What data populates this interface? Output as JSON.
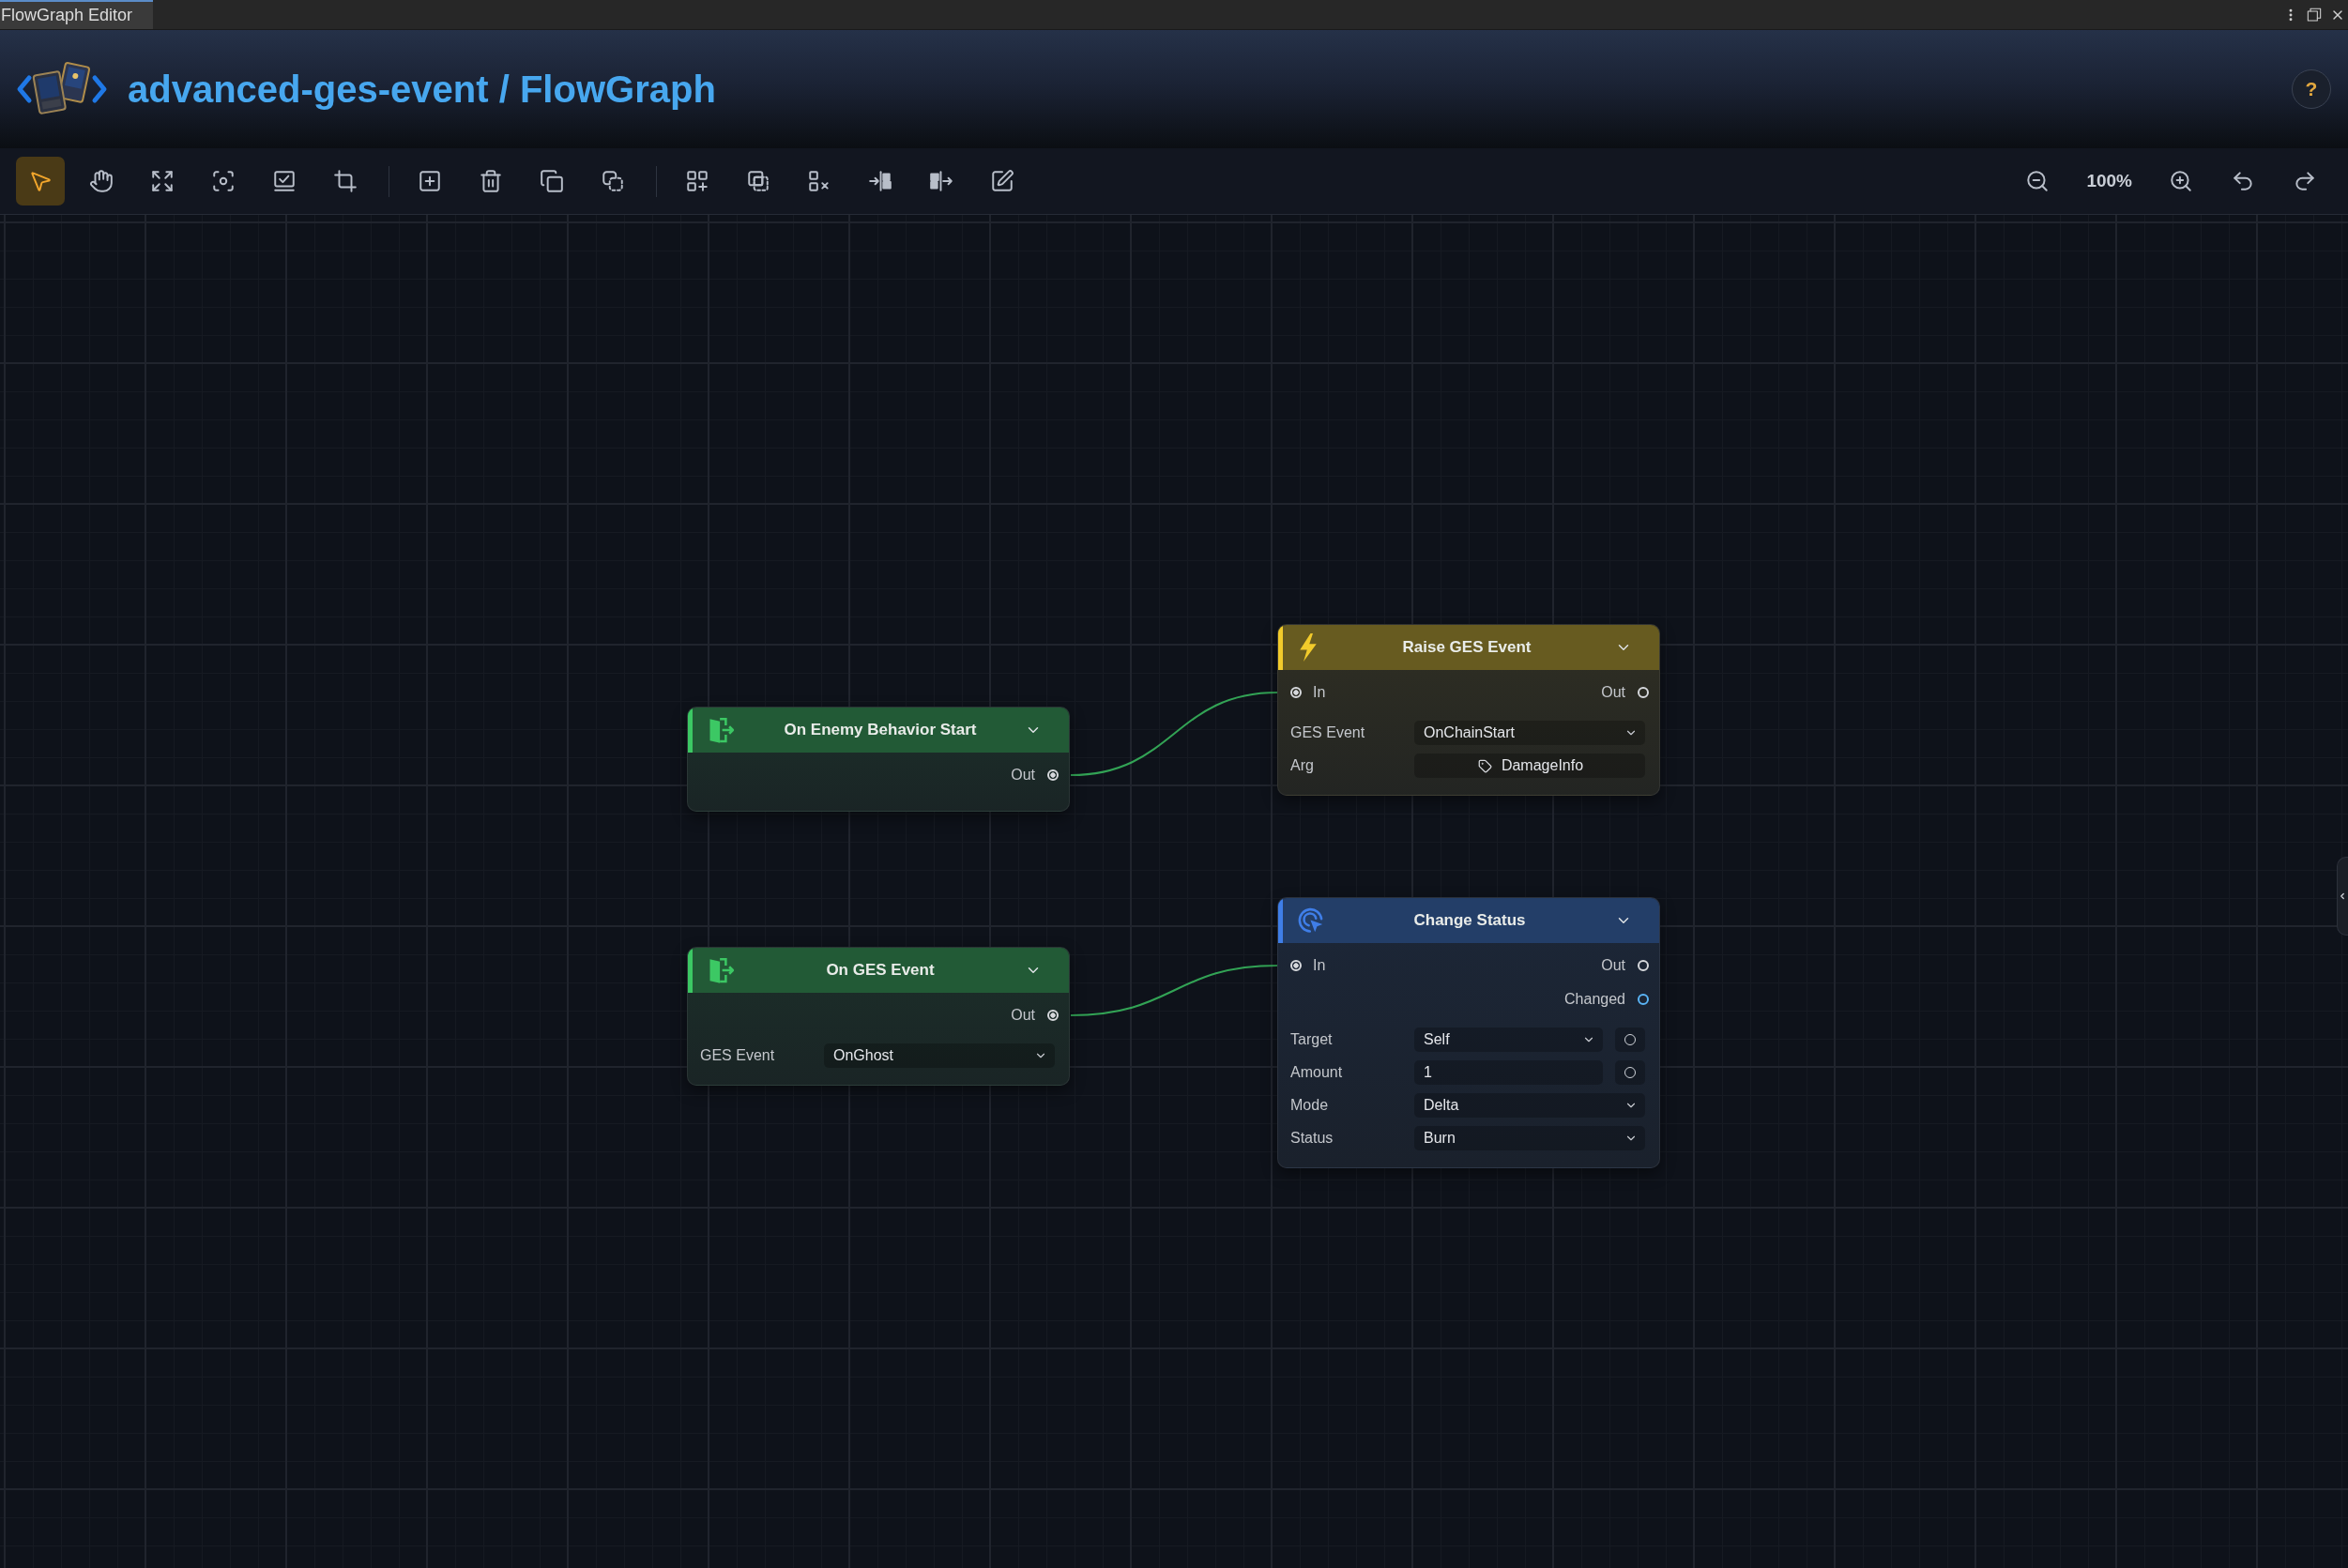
{
  "window": {
    "title": "FlowGraph Editor"
  },
  "header": {
    "title": "advanced-ges-event / FlowGraph",
    "help": "?"
  },
  "toolbar": {
    "groups": [
      {
        "tools": [
          {
            "selected": true
          },
          {
            "selected": false
          },
          {
            "selected": false
          },
          {
            "selected": false
          },
          {
            "selected": false
          },
          {
            "selected": false
          }
        ]
      },
      {
        "tools": [
          {
            "selected": false
          },
          {
            "selected": false
          },
          {
            "selected": false
          },
          {
            "selected": false
          }
        ]
      },
      {
        "tools": [
          {
            "selected": false
          },
          {
            "selected": false
          },
          {
            "selected": false
          },
          {
            "selected": false
          },
          {
            "selected": false
          },
          {
            "selected": false
          }
        ]
      }
    ],
    "zoom": "100%"
  },
  "graph": {
    "nodes": [
      {
        "kind": "event",
        "color": "#3cc864",
        "title": "On Enemy Behavior Start",
        "outputs": [
          {
            "label": "Out",
            "color": "#d6d8dc",
            "connected": true
          }
        ]
      },
      {
        "kind": "event",
        "color": "#3cc864",
        "title": "On GES Event",
        "outputs": [
          {
            "label": "Out",
            "color": "#d6d8dc",
            "connected": true
          }
        ],
        "fields": [
          {
            "kind": "dropdown",
            "label": "GES Event",
            "value": "OnGhost"
          }
        ]
      },
      {
        "kind": "action",
        "color": "#f2cb2b",
        "title": "Raise GES Event",
        "inputs": [
          {
            "label": "In",
            "color": "#d6d8dc",
            "connected": true
          }
        ],
        "outputs": [
          {
            "label": "Out",
            "color": "#d6d8dc",
            "connected": false
          }
        ],
        "fields": [
          {
            "kind": "dropdown",
            "label": "GES Event",
            "value": "OnChainStart"
          },
          {
            "kind": "type",
            "label": "Arg",
            "value": "DamageInfo"
          }
        ]
      },
      {
        "kind": "status",
        "color": "#3f7ee8",
        "title": "Change Status",
        "inputs": [
          {
            "label": "In",
            "color": "#d6d8dc",
            "connected": true
          }
        ],
        "outputs": [
          {
            "label": "Out",
            "color": "#d6d8dc",
            "connected": false
          },
          {
            "label": "Changed",
            "color": "#5ab4f5",
            "connected": false
          }
        ],
        "fields": [
          {
            "kind": "dropdown",
            "label": "Target",
            "value": "Self",
            "socket": {
              "connected": false
            }
          },
          {
            "kind": "text",
            "label": "Amount",
            "value": "1",
            "socket": {
              "connected": false
            }
          },
          {
            "kind": "dropdown",
            "label": "Mode",
            "value": "Delta"
          },
          {
            "kind": "dropdown",
            "label": "Status",
            "value": "Burn"
          }
        ]
      }
    ]
  }
}
